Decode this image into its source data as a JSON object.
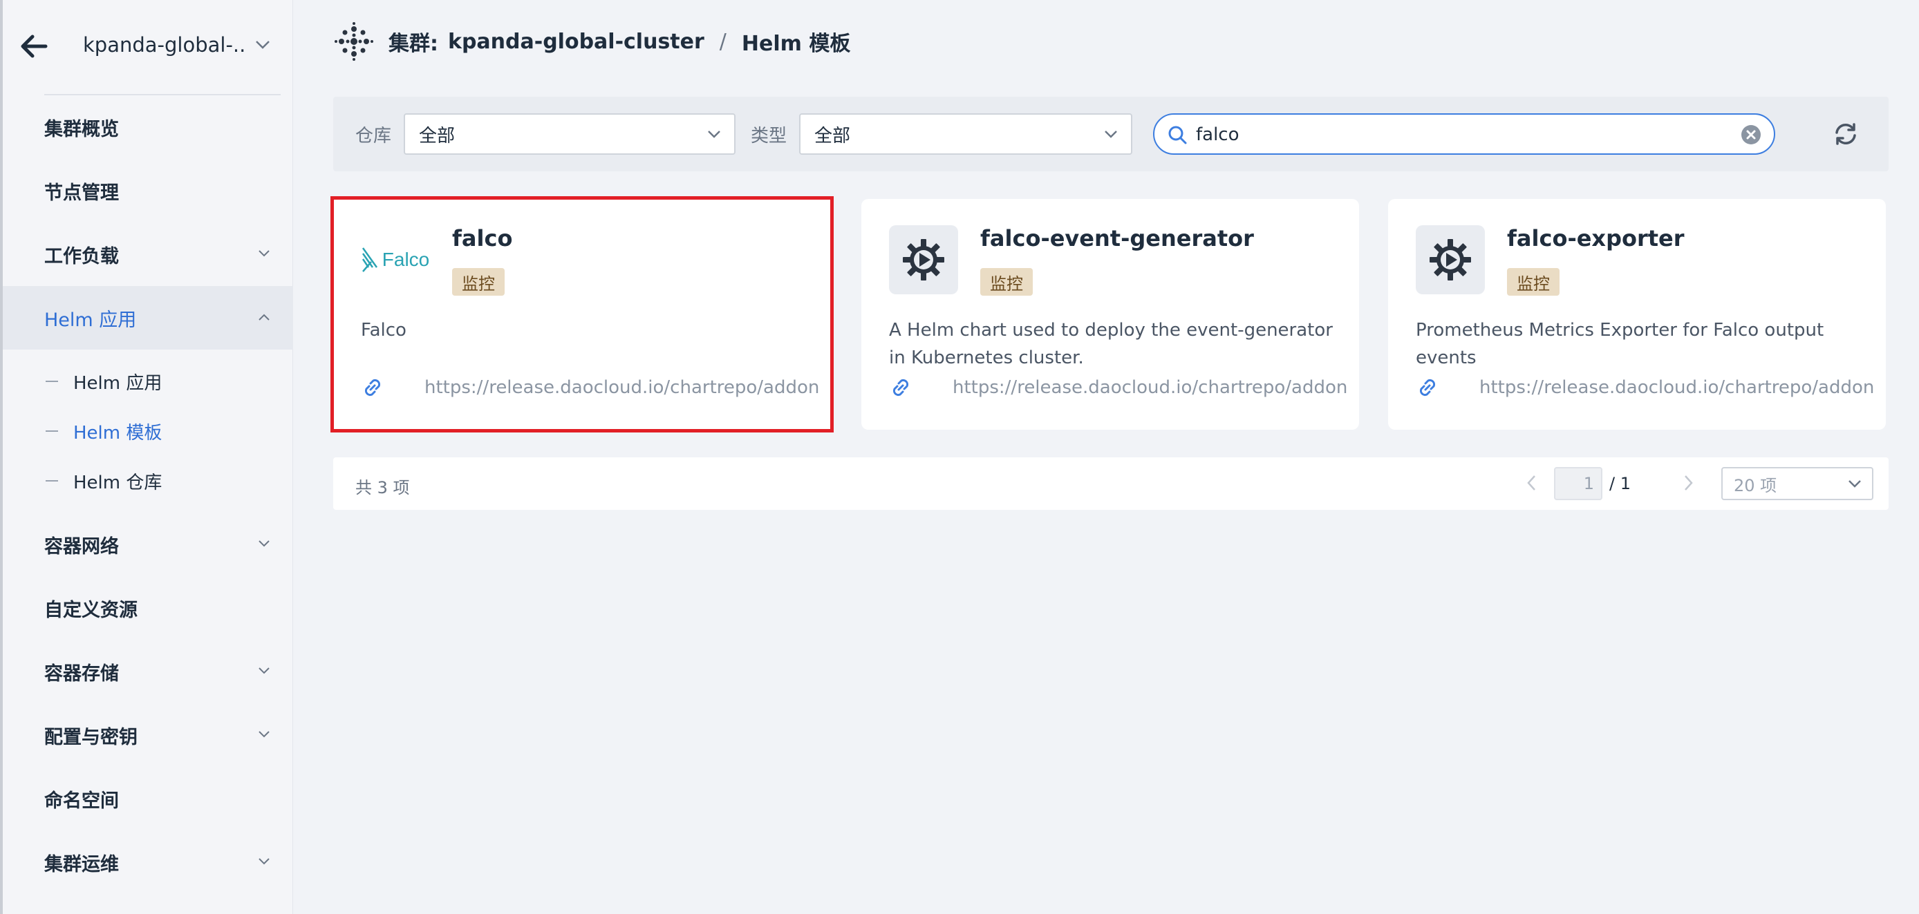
{
  "sidebar": {
    "cluster_name": "kpanda-global-...",
    "items": [
      {
        "label": "集群概览"
      },
      {
        "label": "节点管理"
      },
      {
        "label": "工作负载"
      },
      {
        "label": "Helm 应用"
      },
      {
        "label": "容器网络"
      },
      {
        "label": "自定义资源"
      },
      {
        "label": "容器存储"
      },
      {
        "label": "配置与密钥"
      },
      {
        "label": "命名空间"
      },
      {
        "label": "集群运维"
      }
    ],
    "sub_items": [
      {
        "label": "Helm 应用"
      },
      {
        "label": "Helm 模板"
      },
      {
        "label": "Helm 仓库"
      }
    ]
  },
  "header": {
    "cluster_prefix": "集群:",
    "cluster": "kpanda-global-cluster",
    "separator": "/",
    "page": "Helm 模板"
  },
  "filters": {
    "repo_label": "仓库",
    "repo_value": "全部",
    "type_label": "类型",
    "type_value": "全部",
    "search_value": "falco"
  },
  "cards": [
    {
      "title": "falco",
      "tag": "监控",
      "logo_text": "Falco",
      "description": "Falco",
      "url": "https://release.daocloud.io/chartrepo/addon"
    },
    {
      "title": "falco-event-generator",
      "tag": "监控",
      "description": "A Helm chart used to deploy the event-generator in Kubernetes cluster.",
      "url": "https://release.daocloud.io/chartrepo/addon"
    },
    {
      "title": "falco-exporter",
      "tag": "监控",
      "description": "Prometheus Metrics Exporter for Falco output events",
      "url": "https://release.daocloud.io/chartrepo/addon"
    }
  ],
  "pagination": {
    "total_text": "共 3 项",
    "current_page": "1",
    "total_pages": "/ 1",
    "page_size": "20 项"
  },
  "colors": {
    "accent": "#2f6ed4",
    "highlight": "#e21f26",
    "tag_bg": "#eadcc4"
  }
}
